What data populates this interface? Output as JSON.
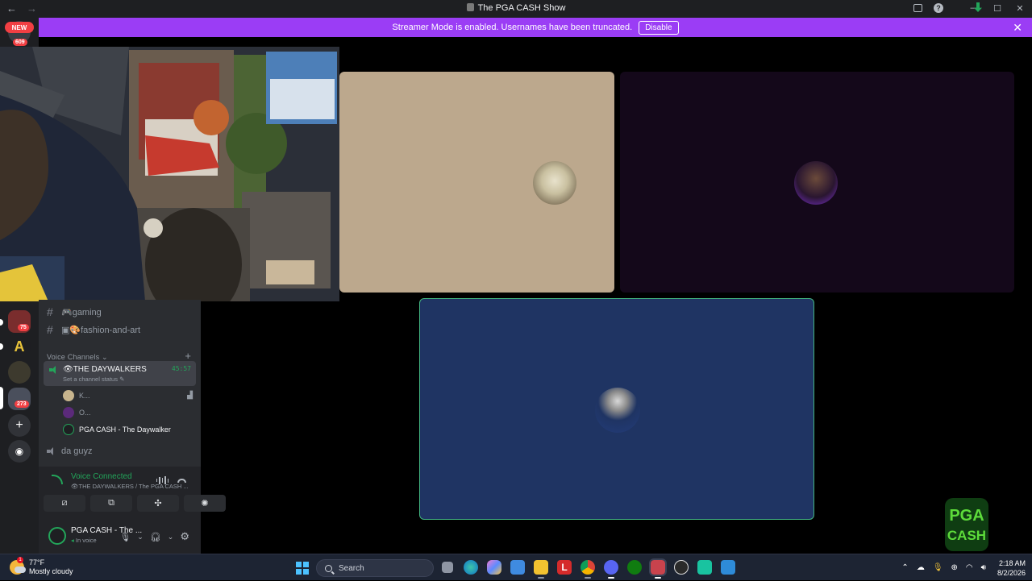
{
  "window": {
    "title": "The PGA CASH Show"
  },
  "banner": {
    "message": "Streamer Mode is enabled. Usernames have been truncated.",
    "disable_label": "Disable"
  },
  "guilds": {
    "new_label": "NEW",
    "badges": [
      "609",
      "75",
      "273"
    ]
  },
  "channels": {
    "text": [
      {
        "label": "🎮gaming"
      },
      {
        "label": "▣🎨fashion-and-art"
      }
    ],
    "voice_header": "Voice Channels",
    "active_voice": {
      "name": "👁THE DAYWALKERS",
      "time": "45:57",
      "status": "Set a channel status"
    },
    "members": [
      "K...",
      "O...",
      "PGA CASH - The Daywalker"
    ],
    "other_voice": "da guyz"
  },
  "voice_panel": {
    "title": "Voice Connected",
    "subtitle": "👁THE DAYWALKERS / The PGA CASH ..."
  },
  "user": {
    "name": "PGA CASH - The ...",
    "status": "In voice"
  },
  "taskbar": {
    "temperature": "77°F",
    "condition": "Mostly cloudy",
    "search_placeholder": "Search",
    "time": "2:18 AM",
    "date": "8/2/2026"
  },
  "colors": {
    "banner": "#9b3df5",
    "voice_green": "#23a55a",
    "tile_beige": "#bca88d",
    "tile_purple": "#14081a",
    "tile_navy": "#1f3463",
    "speaking_border": "#43b581"
  }
}
